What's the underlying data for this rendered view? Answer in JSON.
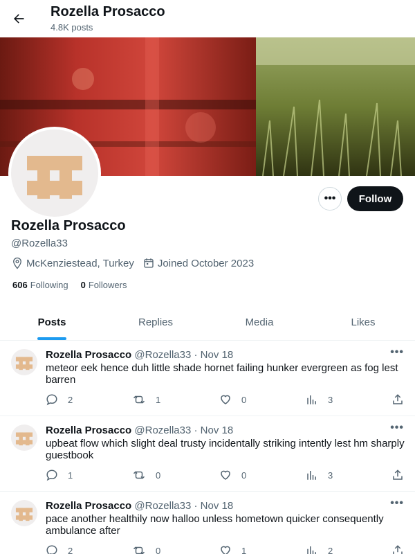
{
  "header": {
    "title": "Rozella Prosacco",
    "post_count": "4.8K posts"
  },
  "profile": {
    "name": "Rozella Prosacco",
    "handle": "@Rozella33",
    "location": "McKenziestead, Turkey",
    "joined": "Joined October 2023",
    "following_count": "606",
    "following_label": "Following",
    "followers_count": "0",
    "followers_label": "Followers",
    "follow_button": "Follow",
    "more_button": "•••"
  },
  "tabs": [
    {
      "label": "Posts",
      "active": true
    },
    {
      "label": "Replies",
      "active": false
    },
    {
      "label": "Media",
      "active": false
    },
    {
      "label": "Likes",
      "active": false
    }
  ],
  "posts": [
    {
      "name": "Rozella Prosacco",
      "handle": "@Rozella33",
      "dot": "·",
      "date": "Nov 18",
      "text": "meteor eek hence duh little shade hornet failing hunker evergreen as fog lest barren",
      "replies": "2",
      "reposts": "1",
      "likes": "0",
      "views": "3"
    },
    {
      "name": "Rozella Prosacco",
      "handle": "@Rozella33",
      "dot": "·",
      "date": "Nov 18",
      "text": "upbeat flow which slight deal trusty incidentally striking intently lest hm sharply guestbook",
      "replies": "1",
      "reposts": "0",
      "likes": "0",
      "views": "3"
    },
    {
      "name": "Rozella Prosacco",
      "handle": "@Rozella33",
      "dot": "·",
      "date": "Nov 18",
      "text": "pace another healthily now halloo unless hometown quicker consequently ambulance after",
      "replies": "2",
      "reposts": "0",
      "likes": "1",
      "views": "2"
    }
  ],
  "colors": {
    "accent": "#1d9bf0",
    "text": "#0f1419",
    "muted": "#536471",
    "avatar_glyph": "#e3b98e"
  },
  "icons": [
    "back-arrow-icon",
    "location-pin-icon",
    "calendar-icon",
    "reply-icon",
    "repost-icon",
    "like-icon",
    "views-icon",
    "share-icon",
    "more-icon"
  ]
}
